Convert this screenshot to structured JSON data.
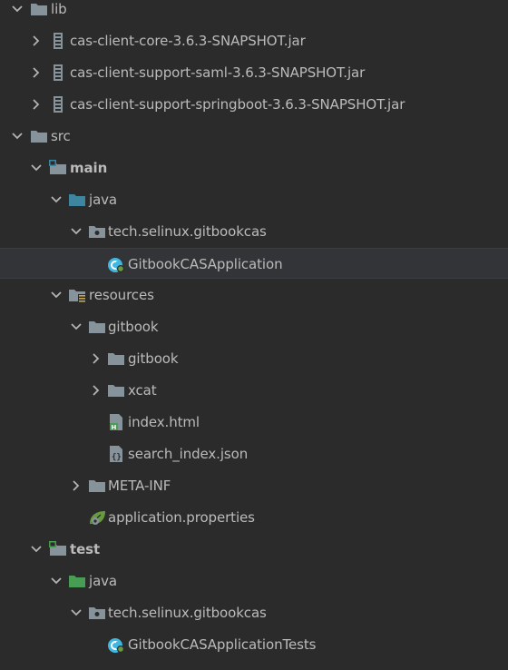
{
  "colors": {
    "background": "#2b2b2b",
    "selected_row": "#323438",
    "text": "#bbbbbb",
    "folder": "#87939a",
    "source_folder": "#3e86a0",
    "test_folder": "#499c54",
    "resources_marker": "#c7a450",
    "spring_leaf": "#6a9a3f",
    "class_icon": "#40b6e0"
  },
  "tree": {
    "rows": [
      {
        "label": "lib",
        "chevron": "down",
        "icon": "folder-icon"
      },
      {
        "label": "cas-client-core-3.6.3-SNAPSHOT.jar",
        "chevron": "right",
        "icon": "jar-icon"
      },
      {
        "label": "cas-client-support-saml-3.6.3-SNAPSHOT.jar",
        "chevron": "right",
        "icon": "jar-icon"
      },
      {
        "label": "cas-client-support-springboot-3.6.3-SNAPSHOT.jar",
        "chevron": "right",
        "icon": "jar-icon"
      },
      {
        "label": "src",
        "chevron": "down",
        "icon": "folder-icon"
      },
      {
        "label": "main",
        "chevron": "down",
        "icon": "module-folder-icon",
        "bold": true
      },
      {
        "label": "java",
        "chevron": "down",
        "icon": "source-folder-icon"
      },
      {
        "label": "tech.selinux.gitbookcas",
        "chevron": "down",
        "icon": "package-icon"
      },
      {
        "label": "GitbookCASApplication",
        "chevron": "none",
        "icon": "spring-boot-class-icon",
        "selected": true
      },
      {
        "label": "resources",
        "chevron": "down",
        "icon": "resources-folder-icon"
      },
      {
        "label": "gitbook",
        "chevron": "down",
        "icon": "folder-icon"
      },
      {
        "label": "gitbook",
        "chevron": "right",
        "icon": "folder-icon"
      },
      {
        "label": "xcat",
        "chevron": "right",
        "icon": "folder-icon"
      },
      {
        "label": "index.html",
        "chevron": "none",
        "icon": "html-file-icon"
      },
      {
        "label": "search_index.json",
        "chevron": "none",
        "icon": "json-file-icon"
      },
      {
        "label": "META-INF",
        "chevron": "right",
        "icon": "folder-icon"
      },
      {
        "label": "application.properties",
        "chevron": "none",
        "icon": "spring-properties-icon"
      },
      {
        "label": "test",
        "chevron": "down",
        "icon": "test-module-folder-icon",
        "bold": true
      },
      {
        "label": "java",
        "chevron": "down",
        "icon": "test-folder-icon"
      },
      {
        "label": "tech.selinux.gitbookcas",
        "chevron": "down",
        "icon": "package-icon"
      },
      {
        "label": "GitbookCASApplicationTests",
        "chevron": "none",
        "icon": "spring-boot-class-icon"
      }
    ]
  }
}
